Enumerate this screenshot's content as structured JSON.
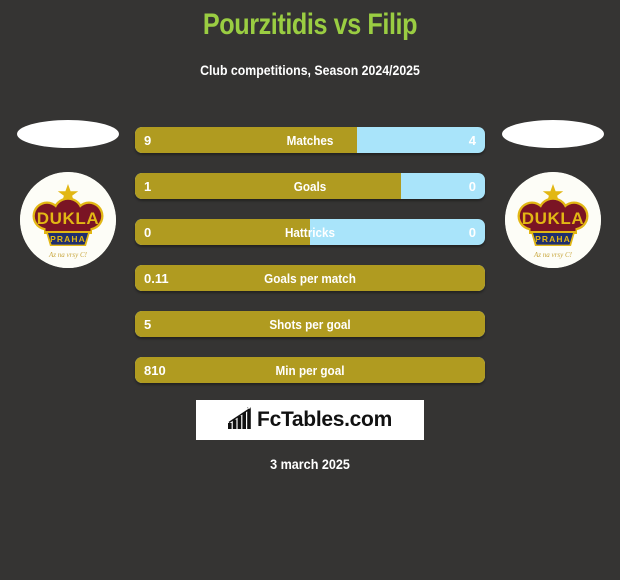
{
  "header": {
    "title": "Pourzitidis vs Filip",
    "subtitle": "Club competitions, Season 2024/2025",
    "title_color": "#9ACD42",
    "subtitle_color": "#ffffff"
  },
  "background_color": "#353433",
  "players": {
    "left": {
      "club_name": "DUKLA",
      "club_city": "PRAHA",
      "club_motto": "Az na vrsy C!",
      "side_color": "#B09B20"
    },
    "right": {
      "club_name": "DUKLA",
      "club_city": "PRAHA",
      "club_motto": "Az na vrsy C!",
      "side_color": "#A9E4FA"
    }
  },
  "chart_data": {
    "type": "bar",
    "title": "Pourzitidis vs Filip",
    "subtitle": "Club competitions, Season 2024/2025",
    "orientation": "horizontal-diverging",
    "categories": [
      "Matches",
      "Goals",
      "Hattricks",
      "Goals per match",
      "Shots per goal",
      "Min per goal"
    ],
    "series": [
      {
        "name": "Pourzitidis",
        "color": "#B09B20",
        "values": [
          "9",
          "1",
          "0",
          "0.11",
          "5",
          "810"
        ]
      },
      {
        "name": "Filip",
        "color": "#A9E4FA",
        "values": [
          "4",
          "0",
          "0",
          "",
          "",
          ""
        ]
      }
    ],
    "legend": "none",
    "grid": false
  },
  "rows": [
    {
      "label": "Matches",
      "left_value": "9",
      "right_value": "4",
      "left_pct": 63.5,
      "show_right": true
    },
    {
      "label": "Goals",
      "left_value": "1",
      "right_value": "0",
      "left_pct": 76.0,
      "show_right": true
    },
    {
      "label": "Hattricks",
      "left_value": "0",
      "right_value": "0",
      "left_pct": 50.0,
      "show_right": true
    },
    {
      "label": "Goals per match",
      "left_value": "0.11",
      "right_value": "",
      "left_pct": 100,
      "show_right": false
    },
    {
      "label": "Shots per goal",
      "left_value": "5",
      "right_value": "",
      "left_pct": 100,
      "show_right": false
    },
    {
      "label": "Min per goal",
      "left_value": "810",
      "right_value": "",
      "left_pct": 100,
      "show_right": false
    }
  ],
  "watermark": {
    "text": "FcTables.com",
    "icon": "bar-chart-icon"
  },
  "footer": {
    "date": "3 march 2025"
  }
}
